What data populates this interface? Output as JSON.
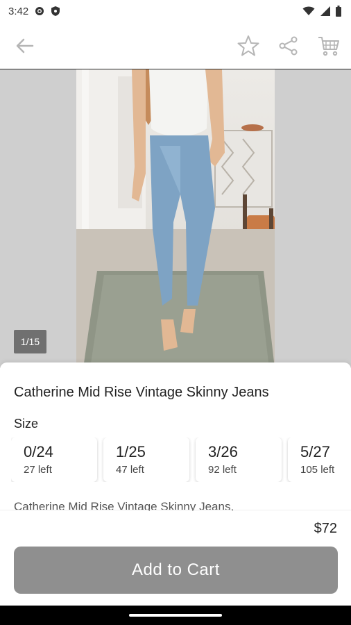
{
  "status_bar": {
    "time": "3:42",
    "icons": [
      "settings-icon",
      "shield-icon",
      "wifi-icon",
      "signal-icon",
      "battery-icon"
    ]
  },
  "app_bar": {
    "icons": [
      "back-arrow-icon",
      "star-icon",
      "share-icon",
      "cart-icon"
    ]
  },
  "gallery": {
    "counter": "1/15"
  },
  "product": {
    "title": "Catherine Mid Rise Vintage Skinny Jeans",
    "size_label": "Size",
    "sizes": [
      {
        "size": "0/24",
        "left": "27 left"
      },
      {
        "size": "1/25",
        "left": "47 left"
      },
      {
        "size": "3/26",
        "left": "92 left"
      },
      {
        "size": "5/27",
        "left": "105 left"
      }
    ],
    "description": "Catherine Mid Rise Vintage Skinny Jeans,",
    "price": "$72",
    "add_to_cart_label": "Add to Cart"
  },
  "colors": {
    "button": "#8f8f8f",
    "hero_bg": "#cfcfcf"
  }
}
